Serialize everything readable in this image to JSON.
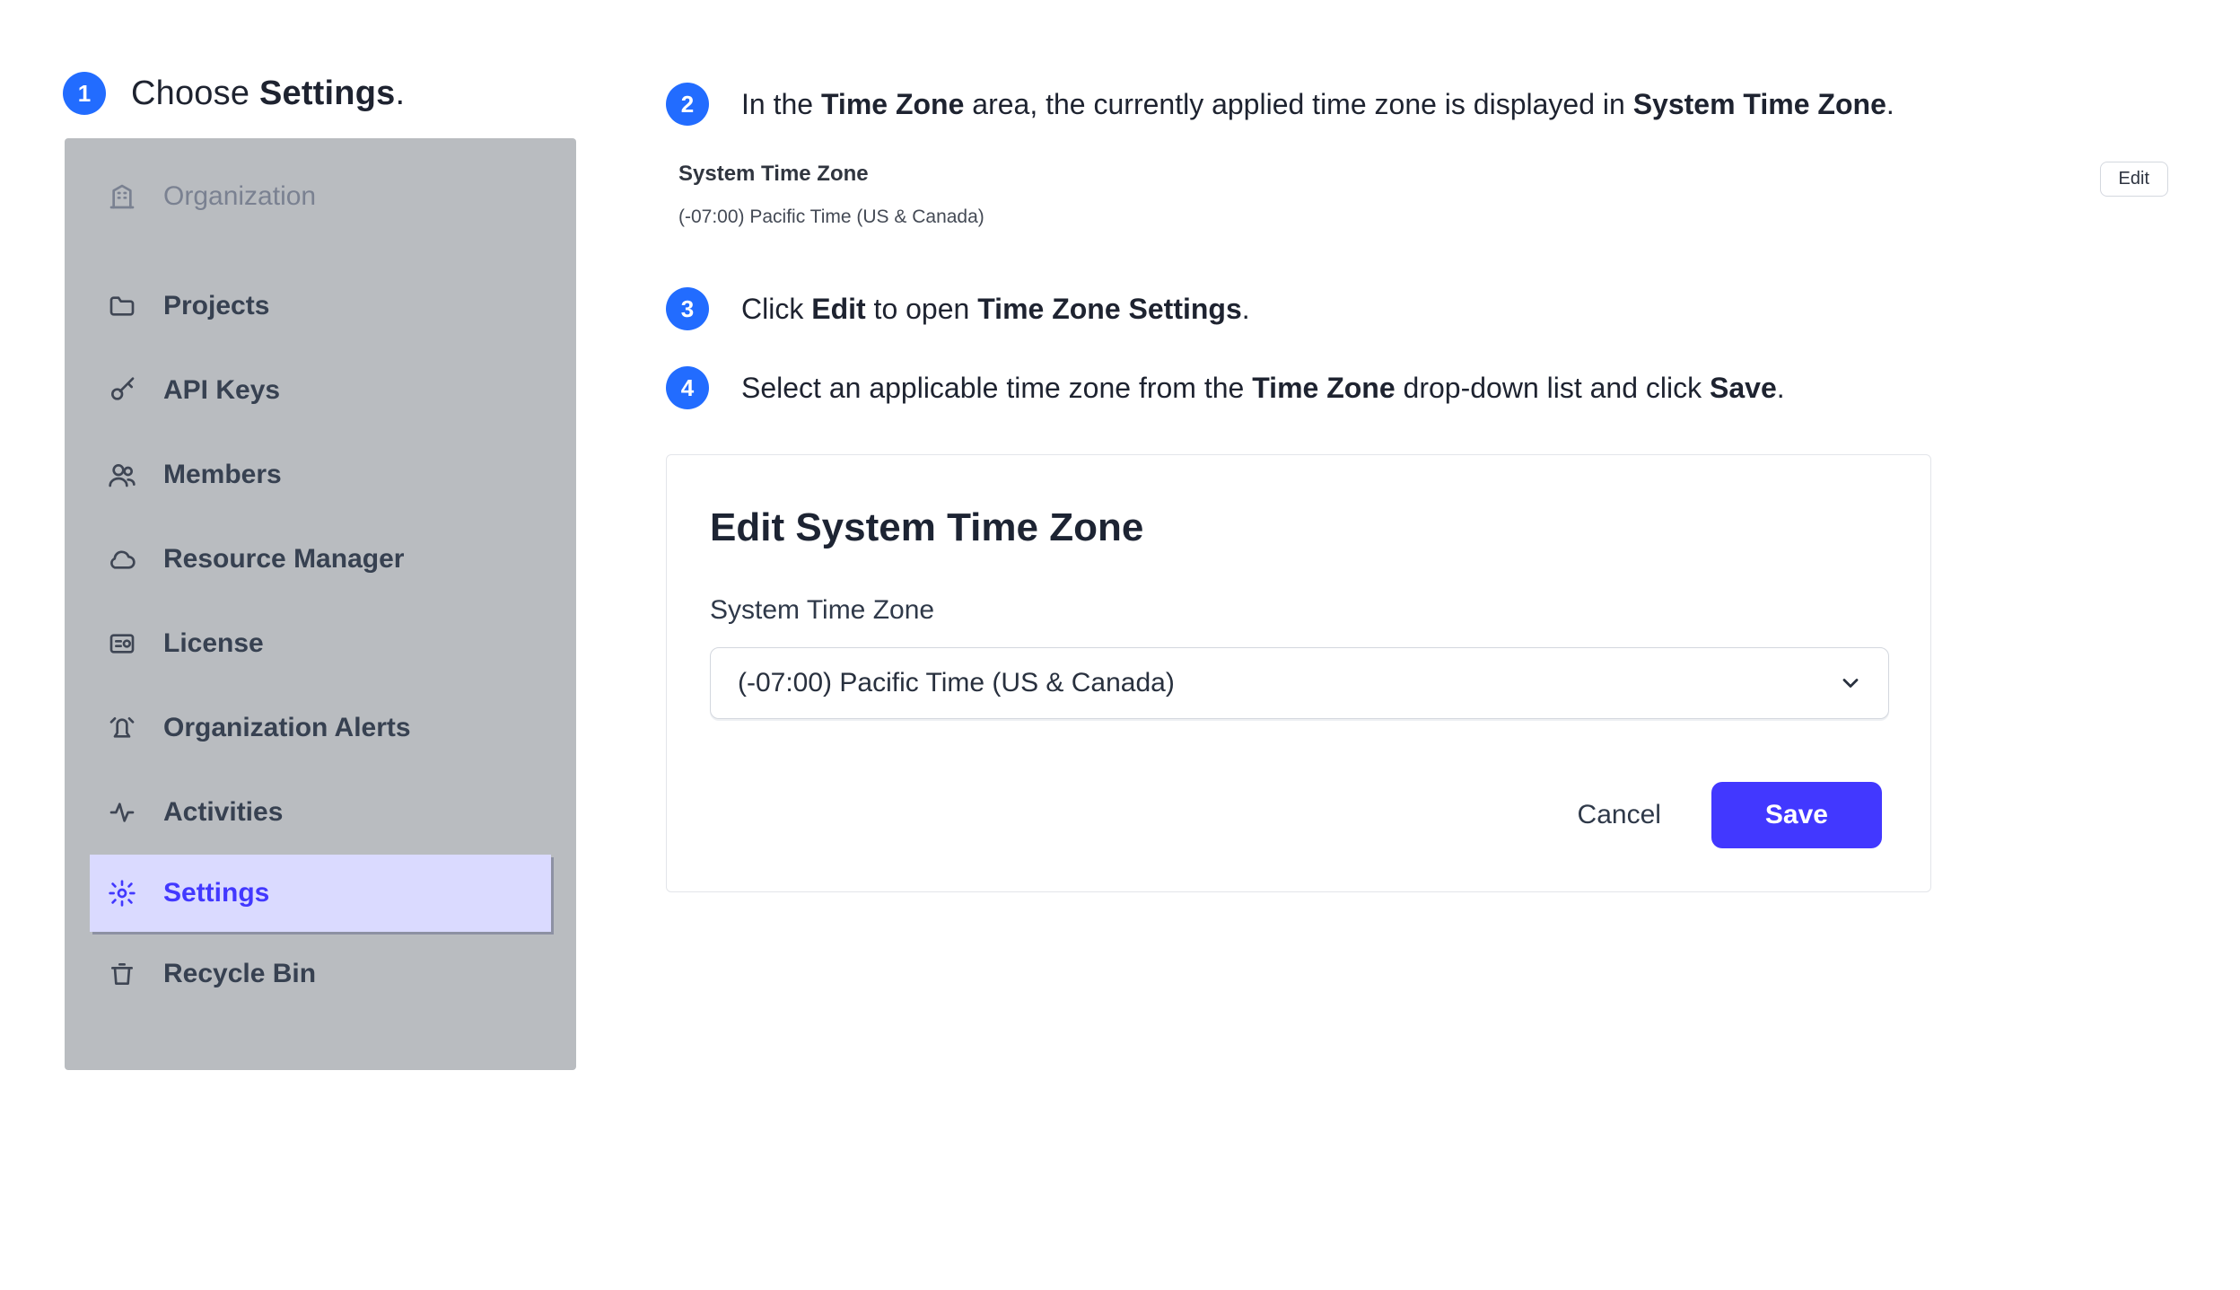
{
  "steps": {
    "1": {
      "pre": "Choose ",
      "bold": "Settings",
      "post": "."
    },
    "2": {
      "segments": [
        "In the ",
        "Time Zone",
        " area, the currently applied time zone is displayed in ",
        "System Time Zone",
        "."
      ]
    },
    "3": {
      "segments": [
        "Click ",
        "Edit",
        " to open ",
        "Time Zone Settings",
        "."
      ]
    },
    "4": {
      "segments": [
        "Select an applicable time zone from the ",
        "Time Zone",
        " drop-down list and click ",
        "Save",
        "."
      ]
    }
  },
  "sidebar": {
    "items": [
      {
        "label": "Organization",
        "icon": "building-icon",
        "disabled": true
      },
      {
        "label": "Projects",
        "icon": "folder-icon"
      },
      {
        "label": "API Keys",
        "icon": "key-icon"
      },
      {
        "label": "Members",
        "icon": "people-icon"
      },
      {
        "label": "Resource Manager",
        "icon": "cloud-icon"
      },
      {
        "label": "License",
        "icon": "license-icon"
      },
      {
        "label": "Organization Alerts",
        "icon": "alert-icon"
      },
      {
        "label": "Activities",
        "icon": "activity-icon"
      },
      {
        "label": "Settings",
        "icon": "gear-icon",
        "active": true
      },
      {
        "label": "Recycle Bin",
        "icon": "trash-icon"
      }
    ]
  },
  "tz_panel": {
    "title": "System Time Zone",
    "value": "(-07:00) Pacific Time (US & Canada)",
    "edit_label": "Edit"
  },
  "dialog": {
    "title": "Edit System Time Zone",
    "field_label": "System Time Zone",
    "select_value": "(-07:00) Pacific Time (US & Canada)",
    "cancel_label": "Cancel",
    "save_label": "Save"
  }
}
